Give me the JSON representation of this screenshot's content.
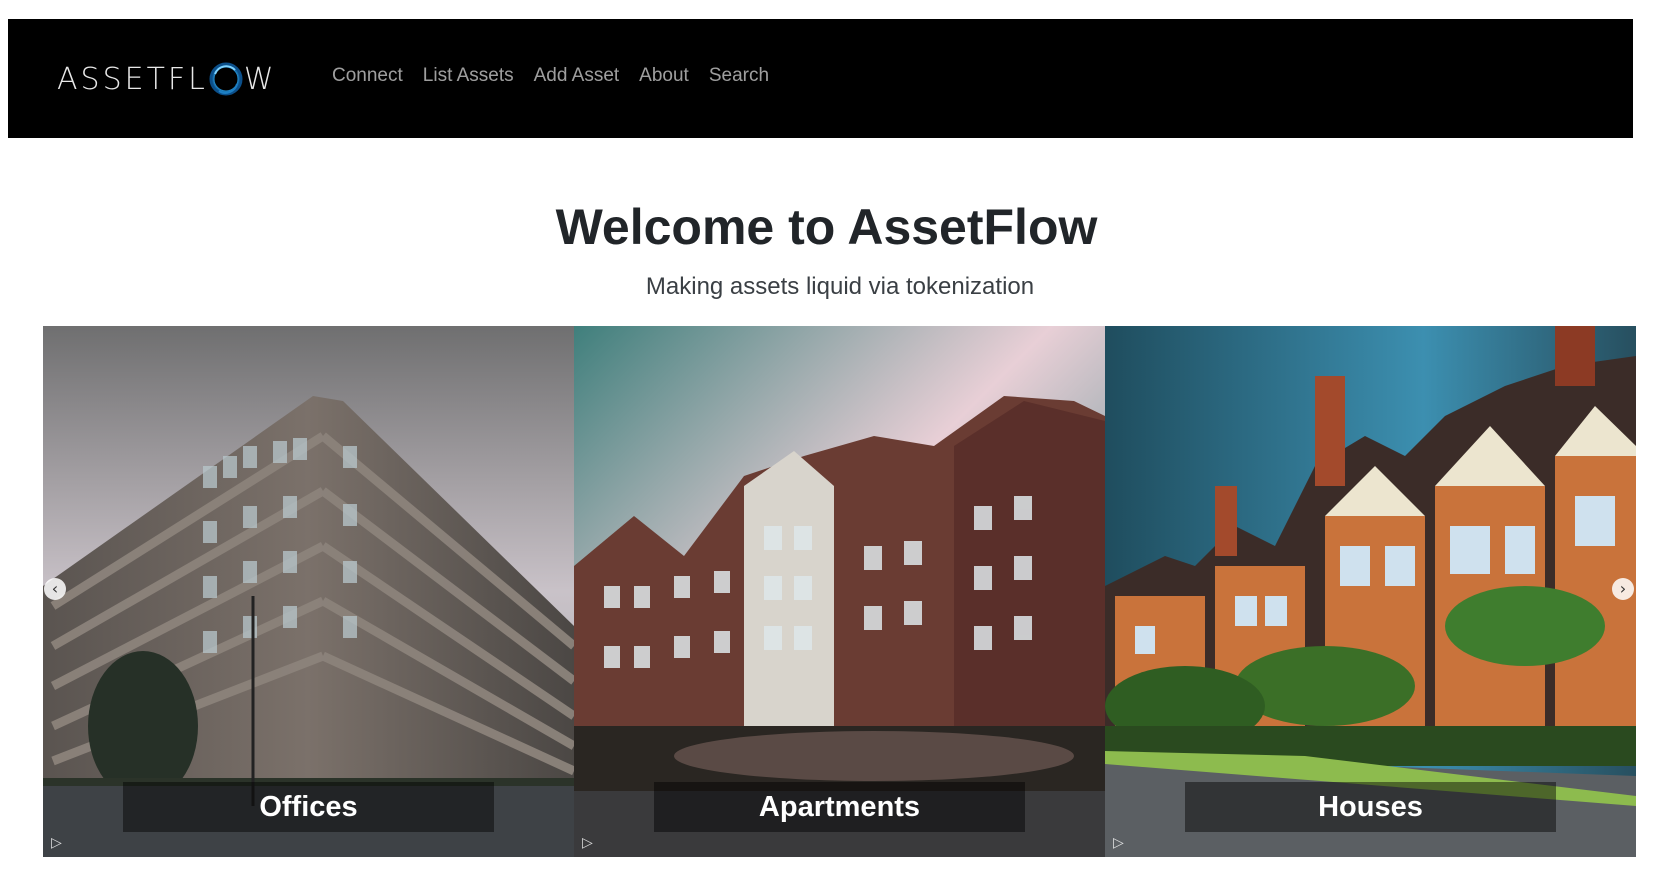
{
  "navbar": {
    "brand_text_left": "ASSETFL",
    "brand_text_right": "W",
    "links": [
      "Connect",
      "List Assets",
      "Add Asset",
      "About",
      "Search"
    ]
  },
  "hero": {
    "title": "Welcome to AssetFlow",
    "subtitle": "Making assets liquid via tokenization"
  },
  "carousel": {
    "slides": [
      {
        "caption": "Offices"
      },
      {
        "caption": "Apartments"
      },
      {
        "caption": "Houses"
      }
    ],
    "prev_icon": "chevron-left-icon",
    "next_icon": "chevron-right-icon"
  },
  "colors": {
    "navbar_bg": "#000000",
    "nav_link": "#9a9a9a",
    "title": "#212529"
  }
}
